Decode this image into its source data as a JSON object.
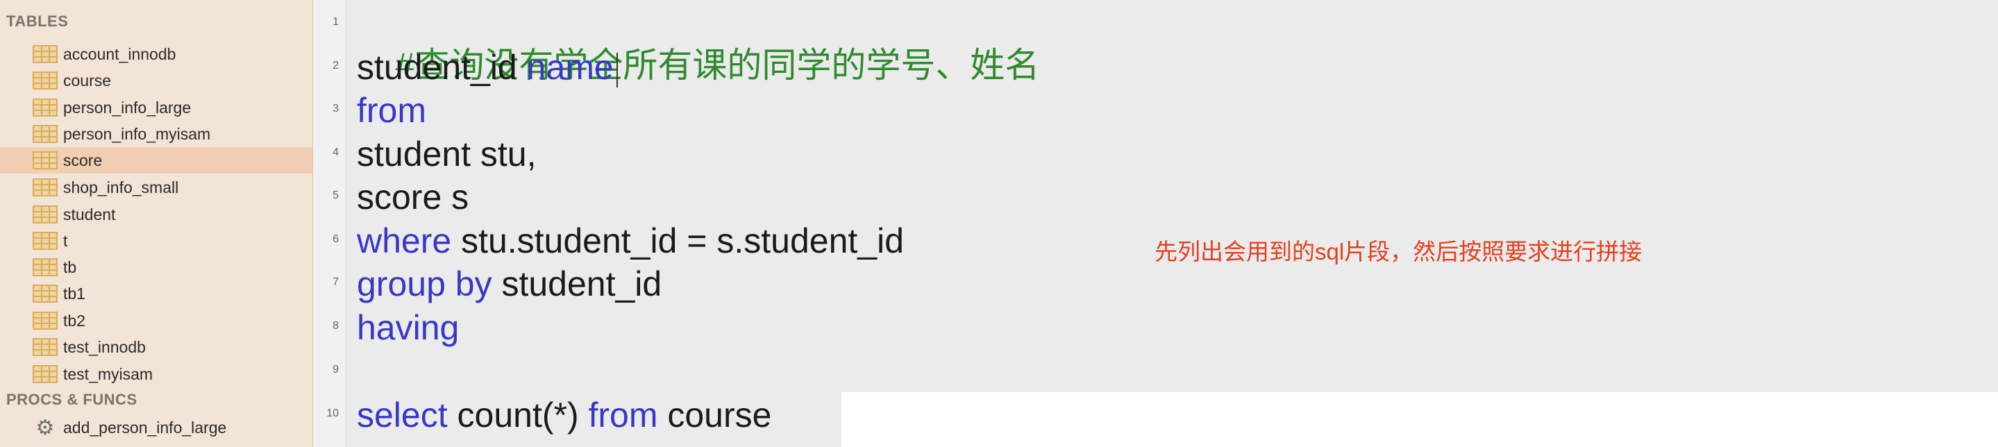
{
  "sidebar": {
    "tables_header": "TABLES",
    "tables": [
      {
        "label": "account_innodb"
      },
      {
        "label": "course"
      },
      {
        "label": "person_info_large"
      },
      {
        "label": "person_info_myisam"
      },
      {
        "label": "score",
        "selected": true
      },
      {
        "label": "shop_info_small"
      },
      {
        "label": "student"
      },
      {
        "label": "t"
      },
      {
        "label": "tb"
      },
      {
        "label": "tb1"
      },
      {
        "label": "tb2"
      },
      {
        "label": "test_innodb"
      },
      {
        "label": "test_myisam"
      }
    ],
    "procs_header": "PROCS & FUNCS",
    "procs": [
      {
        "label": "add_person_info_large"
      }
    ]
  },
  "editor": {
    "line_numbers": [
      "1",
      "2",
      "3",
      "4",
      "5",
      "6",
      "7",
      "8",
      "9",
      "10"
    ],
    "lines": {
      "l1": "#查询没有学全所有课的同学的学号、姓名",
      "l2a": "student_id ",
      "l2b": "name",
      "l3": "from",
      "l4": "student stu,",
      "l5": "score s",
      "l6a": "where",
      "l6b": " stu.student_id = s.student_id",
      "l7a": "group by",
      "l7b": " student_id",
      "l8": "having",
      "l10a": "select",
      "l10b": " count(*) ",
      "l10c": "from",
      "l10d": " course"
    },
    "annotation": "先列出会用到的sql片段，然后按照要求进行拼接"
  },
  "colors": {
    "keyword": "#3737c8",
    "comment": "#2e8b2e",
    "annotation": "#e3401f",
    "sidebar_bg": "#f2e4d6",
    "selected_row": "#f0cfb3"
  }
}
